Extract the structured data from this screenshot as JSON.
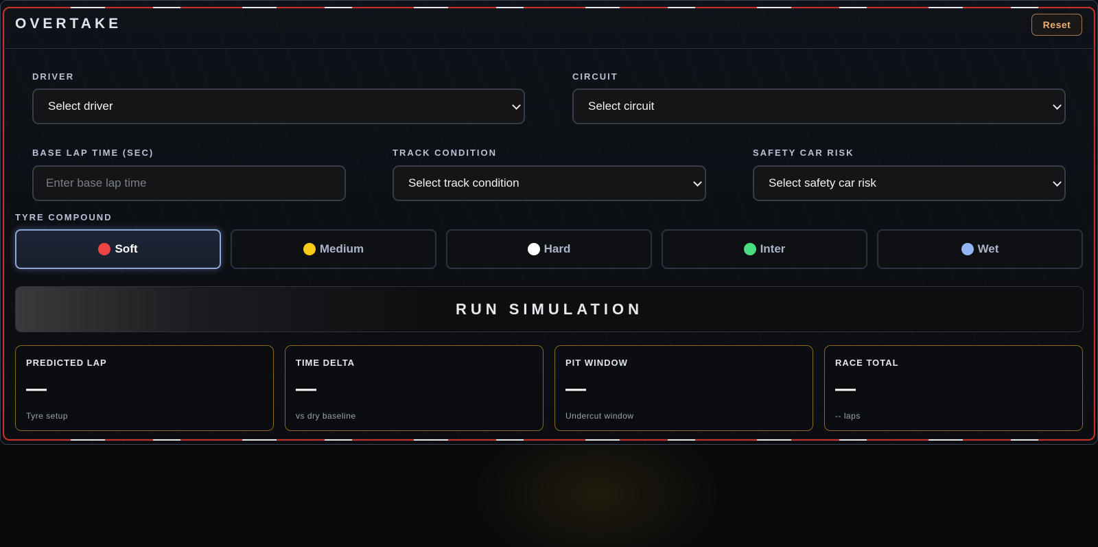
{
  "app": {
    "title": "OVERTAKE",
    "reset_label": "Reset"
  },
  "form": {
    "driver": {
      "label": "DRIVER",
      "value": "Select driver"
    },
    "circuit": {
      "label": "CIRCUIT",
      "value": "Select circuit"
    },
    "base_lap": {
      "label": "BASE LAP TIME (SEC)",
      "placeholder": "Enter base lap time"
    },
    "track_condition": {
      "label": "TRACK CONDITION",
      "value": "Select track condition"
    },
    "safety_car": {
      "label": "SAFETY CAR RISK",
      "value": "Select safety car risk"
    }
  },
  "tyres": {
    "label": "TYRE COMPOUND",
    "selected": "Soft",
    "options": [
      {
        "label": "Soft",
        "color": "#ef4444"
      },
      {
        "label": "Medium",
        "color": "#facc15"
      },
      {
        "label": "Hard",
        "color": "#ffffff"
      },
      {
        "label": "Inter",
        "color": "#4ade80"
      },
      {
        "label": "Wet",
        "color": "#93b4f5"
      }
    ]
  },
  "run_label": "RUN SIMULATION",
  "results": [
    {
      "title": "PREDICTED LAP",
      "value": "—",
      "sub": "Tyre setup"
    },
    {
      "title": "TIME DELTA",
      "value": "—",
      "sub": "vs dry baseline"
    },
    {
      "title": "PIT WINDOW",
      "value": "—",
      "sub": "Undercut window"
    },
    {
      "title": "RACE TOTAL",
      "value": "—",
      "sub": "-- laps"
    }
  ],
  "colors": {
    "accent_red": "#c9302a",
    "accent_gold": "#8a6a1c",
    "reset_orange": "#f0b070"
  }
}
